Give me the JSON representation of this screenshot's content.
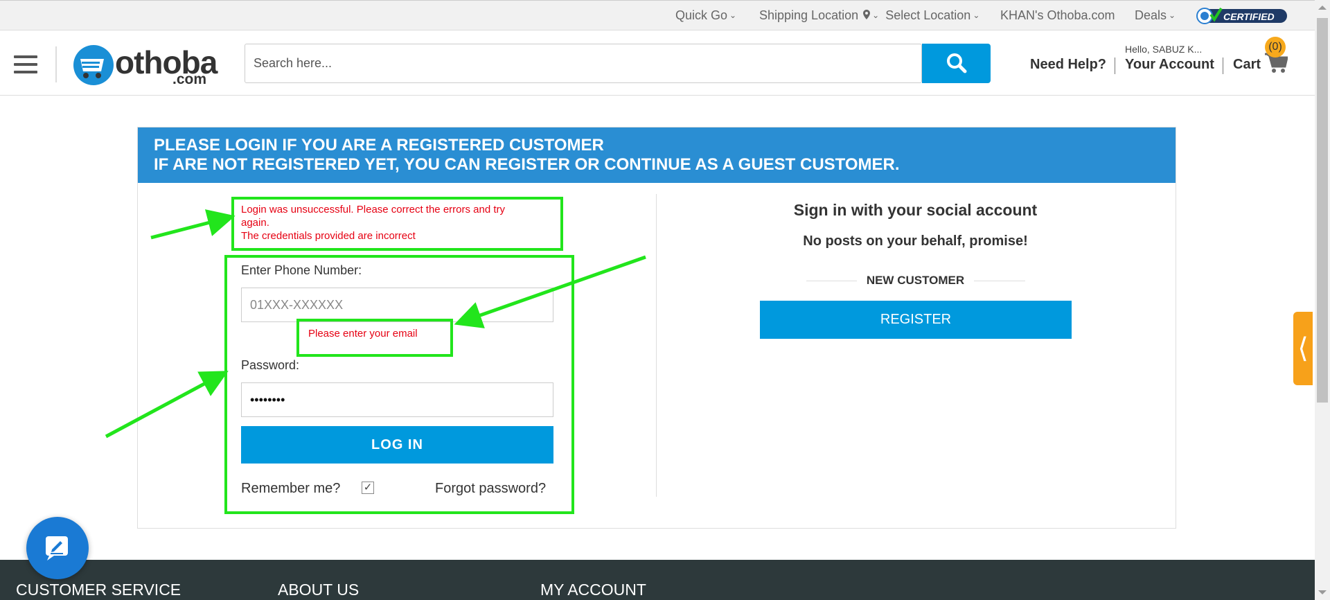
{
  "topbar": {
    "quick_go": "Quick Go",
    "shipping_location": "Shipping Location",
    "select_location": "Select Location",
    "khans": "KHAN's Othoba.com",
    "deals": "Deals",
    "certified": "CERTIFIED"
  },
  "header": {
    "logo_word": "othoba",
    "logo_dotcom": ".com",
    "search_placeholder": "Search here...",
    "need_help": "Need Help?",
    "hello": "Hello, SABUZ K...",
    "your_account": "Your Account",
    "cart": "Cart",
    "cart_count": "(0)"
  },
  "banner": {
    "line1": "PLEASE LOGIN IF YOU ARE A REGISTERED CUSTOMER",
    "line2": "IF ARE NOT REGISTERED YET, YOU CAN REGISTER OR CONTINUE AS A GUEST CUSTOMER."
  },
  "login": {
    "error_line1": "Login was unsuccessful. Please correct the errors and try again.",
    "error_line2": "The credentials provided are incorrect",
    "phone_label": "Enter Phone Number:",
    "phone_placeholder": "01XXX-XXXXXX",
    "email_error": "Please enter your email",
    "password_label": "Password:",
    "password_value": "••••••••",
    "login_button": "LOG IN",
    "remember_me": "Remember me?",
    "remember_checked": true,
    "forgot_password": "Forgot password?"
  },
  "social": {
    "title": "Sign in with your social account",
    "subtitle": "No posts on your behalf, promise!",
    "new_customer": "NEW CUSTOMER",
    "register_button": "REGISTER"
  },
  "footer": {
    "col1": "CUSTOMER SERVICE",
    "col2": "ABOUT US",
    "col3": "MY ACCOUNT"
  },
  "colors": {
    "accent_blue": "#0099dd",
    "banner_blue": "#2a8ed3",
    "error_red": "#e60012",
    "annotation_green": "#22e51c",
    "footer_dark": "#2d393b",
    "badge_orange": "#f7a91c"
  }
}
